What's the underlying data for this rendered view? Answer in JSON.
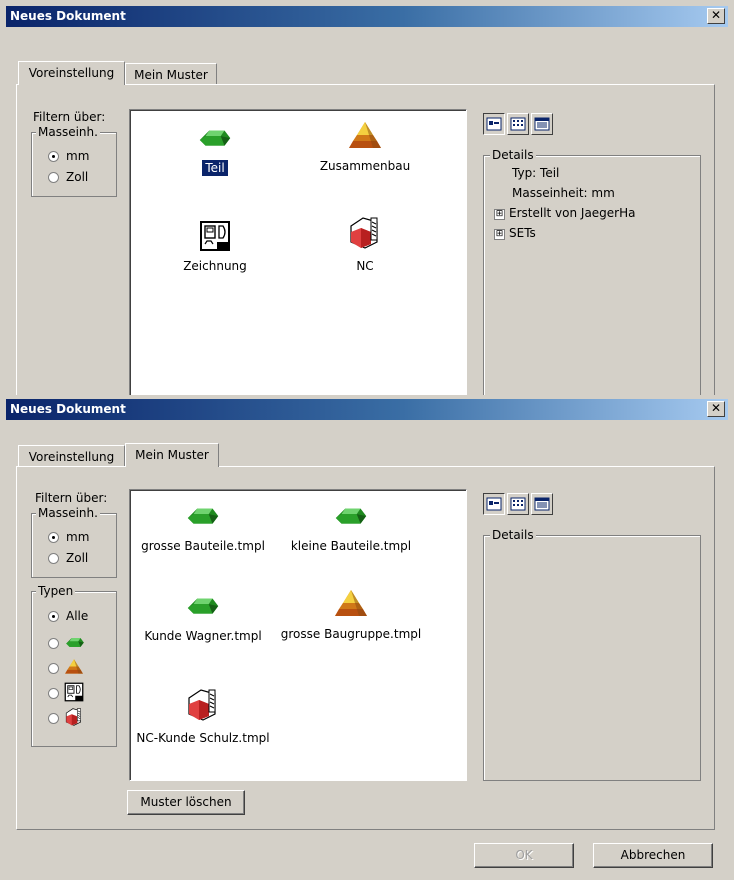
{
  "dialog_title": "Neues Dokument",
  "tabs": [
    "Voreinstellung",
    "Mein Muster"
  ],
  "filter_label": "Filtern über:",
  "units_group": {
    "label": "Masseinh.",
    "options": [
      "mm",
      "Zoll"
    ],
    "selected": "mm"
  },
  "types_group": {
    "label": "Typen",
    "all_label": "Alle",
    "selected": "Alle",
    "type_icons": [
      "part-icon",
      "assembly-icon",
      "drawing-icon",
      "nc-icon"
    ]
  },
  "preset_templates": [
    {
      "name": "Teil",
      "icon": "part-icon",
      "selected": true
    },
    {
      "name": "Zusammenbau",
      "icon": "assembly-icon",
      "selected": false
    },
    {
      "name": "Zeichnung",
      "icon": "drawing-icon",
      "selected": false
    },
    {
      "name": "NC",
      "icon": "nc-icon",
      "selected": false
    }
  ],
  "my_templates": [
    {
      "name": "grosse Bauteile.tmpl",
      "icon": "part-icon"
    },
    {
      "name": "kleine Bauteile.tmpl",
      "icon": "part-icon"
    },
    {
      "name": "Kunde Wagner.tmpl",
      "icon": "part-icon"
    },
    {
      "name": "grosse Baugruppe.tmpl",
      "icon": "assembly-icon"
    },
    {
      "name": "NC-Kunde Schulz.tmpl",
      "icon": "nc-icon"
    }
  ],
  "view_buttons": [
    "large-icons-view-icon",
    "small-icons-view-icon",
    "details-view-icon"
  ],
  "details": {
    "label": "Details",
    "lines": [
      "Typ: Teil",
      "Masseinheit: mm"
    ],
    "expandable": [
      "Erstellt von JaegerHa",
      "SETs"
    ],
    "expand_glyph": "⊞"
  },
  "buttons": {
    "delete": "Muster löschen",
    "ok": "OK",
    "cancel": "Abbrechen",
    "close": "✕"
  },
  "colors": {
    "title_start": "#0a246a",
    "title_end": "#a6caf0",
    "part_green": "#2aa02a",
    "assembly_orange": "#e8a020",
    "nc_red": "#e04040"
  }
}
